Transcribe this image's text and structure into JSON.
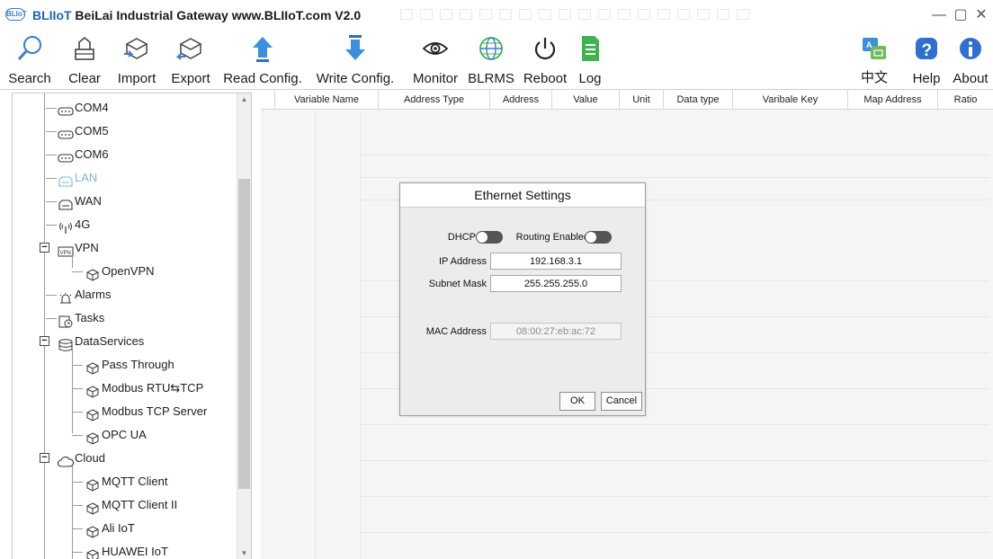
{
  "window": {
    "logo_text": "BLIoT",
    "title_brand": "BLIIoT",
    "title_rest": " BeiLai Industrial Gateway www.BLIIoT.com V2.0",
    "minimize": "—",
    "maximize": "▢",
    "close": "✕"
  },
  "toolbar": {
    "search": "Search",
    "clear": "Clear",
    "import": "Import",
    "export": "Export",
    "read_config": "Read Config.",
    "write_config": "Write Config.",
    "monitor": "Monitor",
    "blrms": "BLRMS",
    "reboot": "Reboot",
    "log": "Log",
    "language": "中文",
    "help": "Help",
    "about": "About"
  },
  "tree": {
    "com4": "COM4",
    "com5": "COM5",
    "com6": "COM6",
    "lan": "LAN",
    "wan": "WAN",
    "g4": "4G",
    "vpn": "VPN",
    "openvpn": "OpenVPN",
    "alarms": "Alarms",
    "tasks": "Tasks",
    "dataservices": "DataServices",
    "pass_through": "Pass Through",
    "modbus_rtu_tcp": "Modbus RTU⇆TCP",
    "modbus_tcp_server": "Modbus TCP Server",
    "opc_ua": "OPC UA",
    "cloud": "Cloud",
    "mqtt_client": "MQTT Client",
    "mqtt_client_2": "MQTT Client II",
    "ali_iot": "Ali IoT",
    "huawei_iot": "HUAWEI IoT",
    "expander_symbol": "−"
  },
  "table": {
    "headers": [
      "Variable Name",
      "Address Type",
      "Address",
      "Value",
      "Unit",
      "Data type",
      "Varibale Key",
      "Map Address",
      "Ratio"
    ]
  },
  "dialog": {
    "title": "Ethernet Settings",
    "dhcp_label": "DHCP",
    "routing_label": "Routing Enabled",
    "dhcp_on": false,
    "routing_on": false,
    "ip_label": "IP Address",
    "ip_value": "192.168.3.1",
    "mask_label": "Subnet Mask",
    "mask_value": "255.255.255.0",
    "mac_label": "MAC Address",
    "mac_value": "08:00:27:eb:ac:72",
    "ok": "OK",
    "cancel": "Cancel"
  },
  "colors": {
    "brand": "#1f62b8",
    "accent_blue": "#3a7bd5",
    "active_tree_item": "#7fb4e6",
    "green": "#3fb34f",
    "toggle_off": "#555555"
  }
}
